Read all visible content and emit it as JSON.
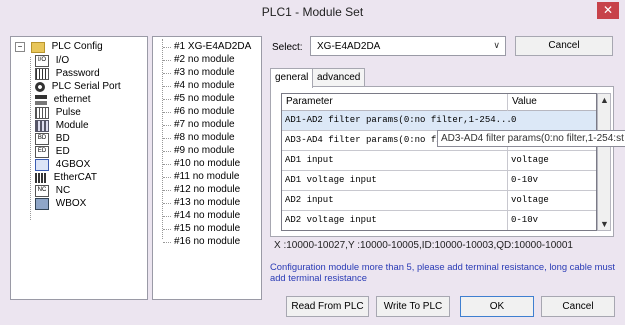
{
  "window": {
    "title": "PLC1 - Module Set",
    "close_glyph": "✕"
  },
  "config_tree": {
    "root": {
      "label": "PLC Config",
      "icon": "folder-icon"
    },
    "items": [
      {
        "label": "I/O",
        "icon": "io-icon"
      },
      {
        "label": "Password",
        "icon": "password-icon"
      },
      {
        "label": "PLC Serial Port",
        "icon": "serial-port-icon"
      },
      {
        "label": "ethernet",
        "icon": "ethernet-icon"
      },
      {
        "label": "Pulse",
        "icon": "pulse-icon"
      },
      {
        "label": "Module",
        "icon": "module-icon"
      },
      {
        "label": "BD",
        "icon": "bd-icon"
      },
      {
        "label": "ED",
        "icon": "ed-icon"
      },
      {
        "label": "4GBOX",
        "icon": "4gbox-icon"
      },
      {
        "label": "EtherCAT",
        "icon": "ethercat-icon"
      },
      {
        "label": "NC",
        "icon": "nc-icon"
      },
      {
        "label": "WBOX",
        "icon": "wbox-icon"
      }
    ]
  },
  "module_tree": {
    "items": [
      "#1 XG-E4AD2DA",
      "#2 no module",
      "#3 no module",
      "#4 no module",
      "#5 no module",
      "#6 no module",
      "#7 no module",
      "#8 no module",
      "#9 no module",
      "#10 no module",
      "#11 no module",
      "#12 no module",
      "#13 no module",
      "#14 no module",
      "#15 no module",
      "#16 no module"
    ]
  },
  "select": {
    "label": "Select:",
    "value": "XG-E4AD2DA",
    "arrow": "∨"
  },
  "buttons": {
    "cancel_top": "Cancel",
    "read": "Read From PLC",
    "write": "Write To PLC",
    "ok": "OK",
    "cancel": "Cancel"
  },
  "tabs": [
    {
      "label": "general",
      "active": true
    },
    {
      "label": "advanced",
      "active": false
    }
  ],
  "grid": {
    "headers": {
      "parameter": "Parameter",
      "value": "Value"
    },
    "rows": [
      {
        "param": "AD1-AD2 filter params(0:no filter,1-254...",
        "value": "0",
        "selected": true
      },
      {
        "param": "AD3-AD4 filter params(0:no fi",
        "value": "",
        "selected": false
      },
      {
        "param": "AD1 input",
        "value": "voltage",
        "selected": false
      },
      {
        "param": "AD1 voltage input",
        "value": "0-10v",
        "selected": false
      },
      {
        "param": "AD2 input",
        "value": "voltage",
        "selected": false
      },
      {
        "param": "AD2 voltage input",
        "value": "0-10v",
        "selected": false
      }
    ],
    "scroll_up": "▲",
    "scroll_down": "▼"
  },
  "tooltip": "AD3-AD4 filter params(0:no filter,1-254:st",
  "address_info": "X :10000-10027,Y :10000-10005,ID:10000-10003,QD:10000-10001",
  "note": "Configuration module more than 5, please add terminal resistance, long cable must add terminal resistance",
  "colors": {
    "selected_row": "#dce8f7",
    "note_text": "#2a3bb5",
    "close_button": "#c7424a"
  }
}
